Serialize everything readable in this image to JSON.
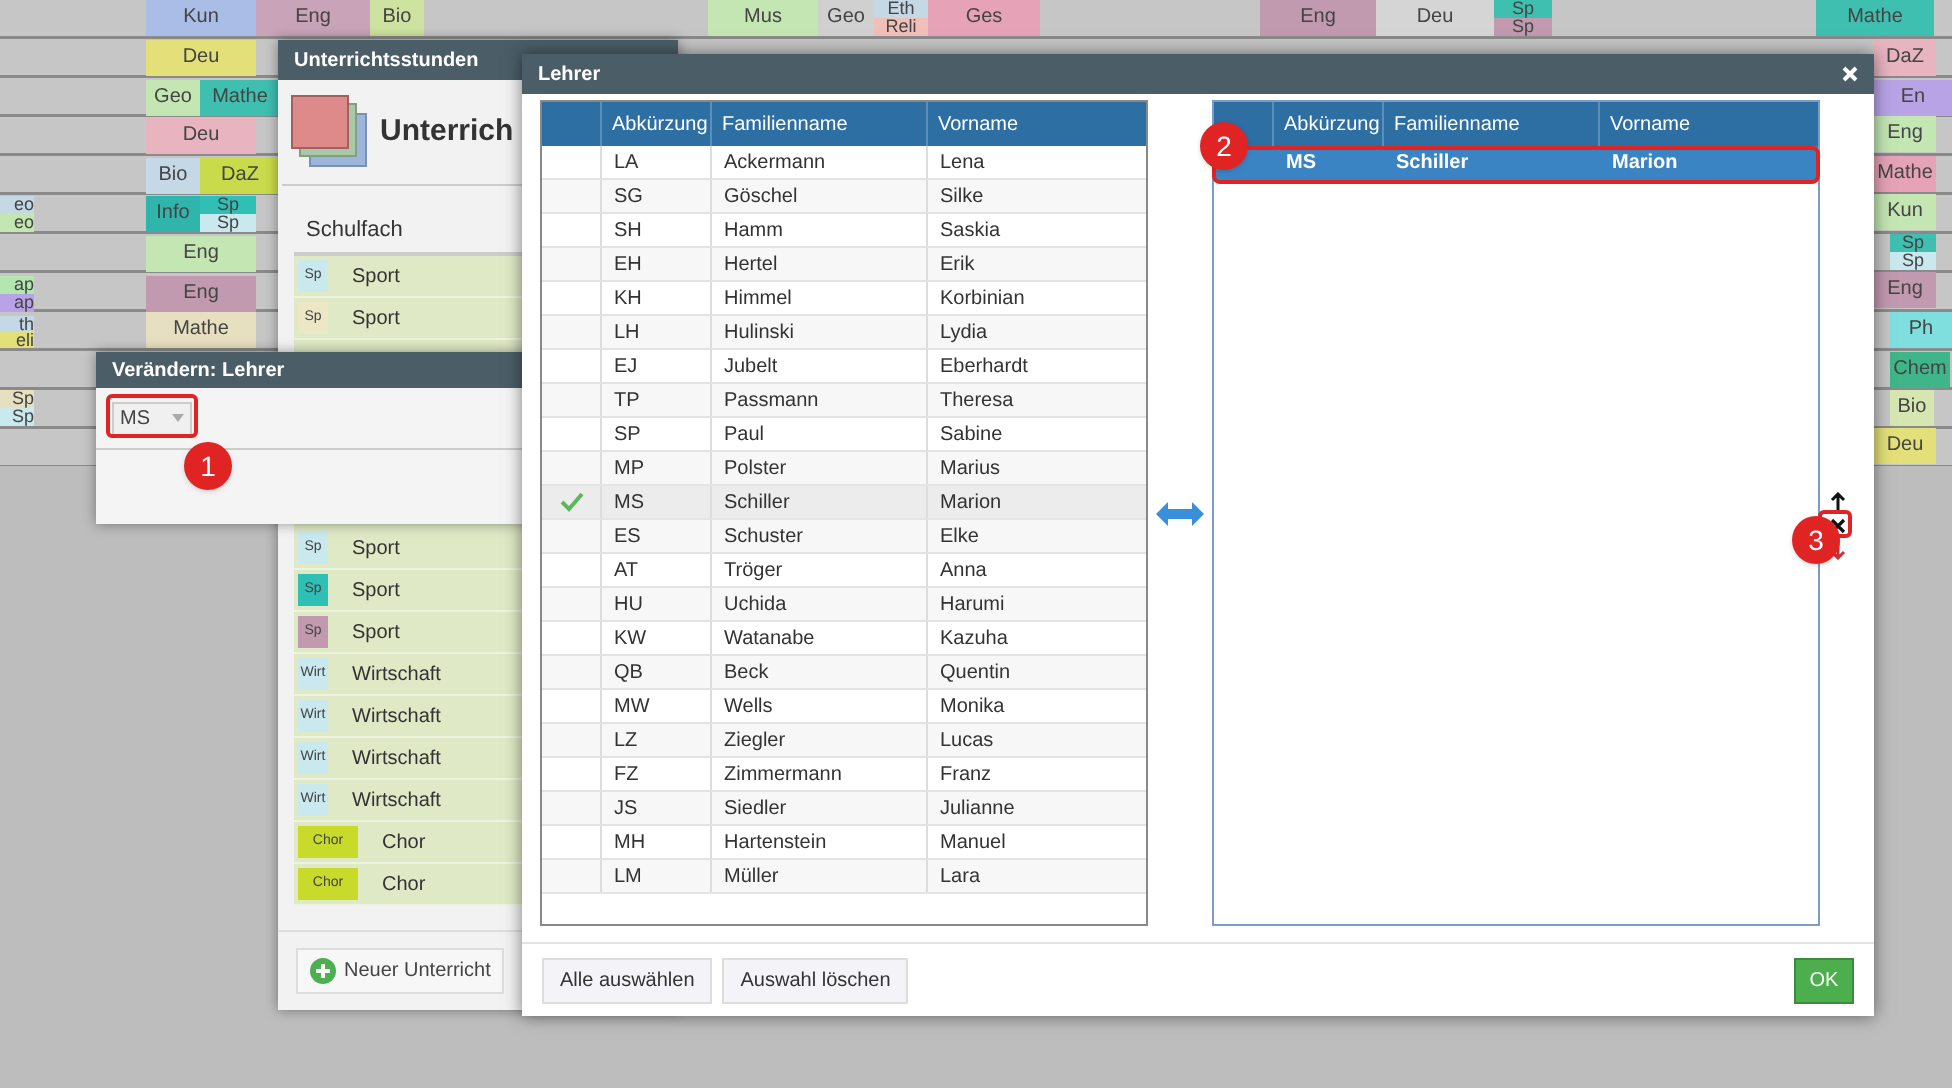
{
  "timetable": {
    "lessons": [
      {
        "label": "Kun",
        "color": "#a9bde6"
      },
      {
        "label": "Eng",
        "color": "#c9a3b8"
      },
      {
        "label": "Bio",
        "color": "#cfe3a0"
      },
      {
        "label": "Deu",
        "color": "#e3e07a"
      },
      {
        "label": "Geo",
        "color": "#c3e6b3"
      },
      {
        "label": "Mathe",
        "color": "#3fbfb0"
      },
      {
        "label": "Deu",
        "color": "#e8b4c0"
      },
      {
        "label": "Bio",
        "color": "#c5d8e6"
      },
      {
        "label": "DaZ",
        "color": "#c9db4a"
      },
      {
        "label": "Info",
        "color": "#2fb5ac"
      },
      {
        "label": "Sp",
        "color": "#2fbfb5"
      },
      {
        "label": "Sp",
        "color": "#c9e9ee"
      },
      {
        "label": "Eng",
        "color": "#c3e6b3"
      },
      {
        "label": "Eng",
        "color": "#c29ab0"
      },
      {
        "label": "Mathe",
        "color": "#e6e0c0"
      },
      {
        "label": "eo",
        "color": "#c5d8e6"
      },
      {
        "label": "eo",
        "color": "#c3e6b3"
      },
      {
        "label": "ap",
        "color": "#b3e6b0"
      },
      {
        "label": "ap",
        "color": "#b8a3e6"
      },
      {
        "label": "th",
        "color": "#c5d8e6"
      },
      {
        "label": "eli",
        "color": "#e3e07a"
      },
      {
        "label": "Sp",
        "color": "#e6e0c0"
      },
      {
        "label": "Sp",
        "color": "#c9e9ee"
      },
      {
        "label": "Mus",
        "color": "#c3e6b3"
      },
      {
        "label": "Geo",
        "color": "#d0d0d0"
      },
      {
        "label": "Eth",
        "color": "#c5d8e6"
      },
      {
        "label": "Reli",
        "color": "#f0c0b8"
      },
      {
        "label": "Ges",
        "color": "#e6a3b8"
      },
      {
        "label": "Eng",
        "color": "#c29ab0"
      },
      {
        "label": "Deu",
        "color": "#d5d5d5"
      },
      {
        "label": "Sp",
        "color": "#3fbfb0"
      },
      {
        "label": "Sp",
        "color": "#c29ab0"
      },
      {
        "label": "Mathe",
        "color": "#3fbfb0"
      },
      {
        "label": "DaZ",
        "color": "#e8b4c0"
      },
      {
        "label": "En",
        "color": "#b8a3e6"
      },
      {
        "label": "Eng",
        "color": "#c3e6b3"
      },
      {
        "label": "Mathe",
        "color": "#e6a3b8"
      },
      {
        "label": "Kun",
        "color": "#c3e6b3"
      },
      {
        "label": "Sp",
        "color": "#3fbfb0"
      },
      {
        "label": "Sp",
        "color": "#c9e9ee"
      },
      {
        "label": "Eng",
        "color": "#c29ab0"
      },
      {
        "label": "Ph",
        "color": "#7fdede"
      },
      {
        "label": "Chem",
        "color": "#3fb58a"
      },
      {
        "label": "Bio",
        "color": "#d5e6b0"
      },
      {
        "label": "Deu",
        "color": "#e3e07a"
      }
    ]
  },
  "lessons_window": {
    "title": "Unterrichtsstunden",
    "heading": "Unterrich",
    "column": "Schulfach",
    "rows_above": [
      {
        "tag": "Sp",
        "subject": "Sport",
        "color": "#c9e9ee"
      },
      {
        "tag": "Sp",
        "subject": "Sport",
        "color": "#ece7c4"
      }
    ],
    "rows_below": [
      {
        "tag": "Sp",
        "subject": "Sport",
        "color": "#c9e9ee"
      },
      {
        "tag": "Sp",
        "subject": "Sport",
        "color": "#2fbfb5"
      },
      {
        "tag": "Sp",
        "subject": "Sport",
        "color": "#c29ab0"
      },
      {
        "tag": "Wirt",
        "subject": "Wirtschaft",
        "color": "#c9e9ee"
      },
      {
        "tag": "Wirt",
        "subject": "Wirtschaft",
        "color": "#c9e9ee"
      },
      {
        "tag": "Wirt",
        "subject": "Wirtschaft",
        "color": "#c9e9ee"
      },
      {
        "tag": "Wirt",
        "subject": "Wirtschaft",
        "color": "#c9e9ee"
      },
      {
        "tag": "Chor",
        "subject": "Chor",
        "color": "#c9db2a"
      },
      {
        "tag": "Chor",
        "subject": "Chor",
        "color": "#c9db2a"
      }
    ],
    "new_button": "Neuer Unterricht"
  },
  "change_dialog": {
    "title": "Verändern: Lehrer",
    "value": "MS"
  },
  "teacher_dialog": {
    "title": "Lehrer",
    "columns": [
      "Abkürzung",
      "Familienname",
      "Vorname"
    ],
    "teachers": [
      {
        "abbr": "LA",
        "last": "Ackermann",
        "first": "Lena",
        "checked": false
      },
      {
        "abbr": "SG",
        "last": "Göschel",
        "first": "Silke",
        "checked": false
      },
      {
        "abbr": "SH",
        "last": "Hamm",
        "first": "Saskia",
        "checked": false
      },
      {
        "abbr": "EH",
        "last": "Hertel",
        "first": "Erik",
        "checked": false
      },
      {
        "abbr": "KH",
        "last": "Himmel",
        "first": "Korbinian",
        "checked": false
      },
      {
        "abbr": "LH",
        "last": "Hulinski",
        "first": "Lydia",
        "checked": false
      },
      {
        "abbr": "EJ",
        "last": "Jubelt",
        "first": "Eberhardt",
        "checked": false
      },
      {
        "abbr": "TP",
        "last": "Passmann",
        "first": "Theresa",
        "checked": false
      },
      {
        "abbr": "SP",
        "last": "Paul",
        "first": "Sabine",
        "checked": false
      },
      {
        "abbr": "MP",
        "last": "Polster",
        "first": "Marius",
        "checked": false
      },
      {
        "abbr": "MS",
        "last": "Schiller",
        "first": "Marion",
        "checked": true
      },
      {
        "abbr": "ES",
        "last": "Schuster",
        "first": "Elke",
        "checked": false
      },
      {
        "abbr": "AT",
        "last": "Tröger",
        "first": "Anna",
        "checked": false
      },
      {
        "abbr": "HU",
        "last": "Uchida",
        "first": "Harumi",
        "checked": false
      },
      {
        "abbr": "KW",
        "last": "Watanabe",
        "first": "Kazuha",
        "checked": false
      },
      {
        "abbr": "QB",
        "last": "Beck",
        "first": "Quentin",
        "checked": false
      },
      {
        "abbr": "MW",
        "last": "Wells",
        "first": "Monika",
        "checked": false
      },
      {
        "abbr": "LZ",
        "last": "Ziegler",
        "first": "Lucas",
        "checked": false
      },
      {
        "abbr": "FZ",
        "last": "Zimmermann",
        "first": "Franz",
        "checked": false
      },
      {
        "abbr": "JS",
        "last": "Siedler",
        "first": "Julianne",
        "checked": false
      },
      {
        "abbr": "MH",
        "last": "Hartenstein",
        "first": "Manuel",
        "checked": false
      },
      {
        "abbr": "LM",
        "last": "Müller",
        "first": "Lara",
        "checked": false
      }
    ],
    "chosen_columns": [
      "Abkürzung",
      "Familienname",
      "Vorname"
    ],
    "chosen": [
      {
        "abbr": "MS",
        "last": "Schiller",
        "first": "Marion",
        "selected": true
      }
    ],
    "buttons": [
      "Alle auswählen",
      "Auswahl löschen"
    ],
    "ok": "OK"
  },
  "callouts": [
    "1",
    "2",
    "3"
  ]
}
